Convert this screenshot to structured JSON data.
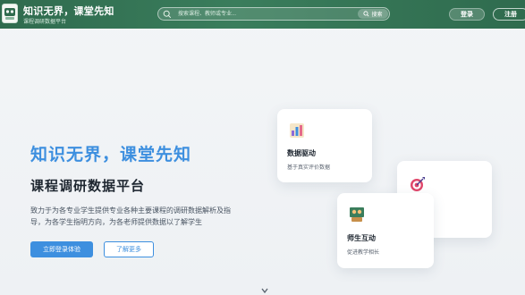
{
  "header": {
    "brand_title": "知识无界，课堂先知",
    "brand_subtitle": "课程调研数据平台",
    "search_placeholder": "搜索课程、教师或专业...",
    "search_button_label": "搜索",
    "login_label": "登录",
    "register_label": "注册",
    "bg_color": "#2f6b4e"
  },
  "hero": {
    "title": "知识无界，课堂先知",
    "subtitle": "课程调研数据平台",
    "description": "致力于为各专业学生提供专业各种主要课程的调研数据解析及指导，为各学生指明方向，为各老师提供数据以了解学生",
    "primary_button": "立即登录体验",
    "secondary_button": "了解更多",
    "accent_color": "#3d8fdf"
  },
  "cards": [
    {
      "icon": "bar-chart-icon",
      "title": "数据驱动",
      "desc": "基于真实评价数据"
    },
    {
      "icon": "target-icon",
      "title": "",
      "desc": ""
    },
    {
      "icon": "teacher-student-icon",
      "title": "师生互动",
      "desc": "促进教学相长"
    }
  ]
}
